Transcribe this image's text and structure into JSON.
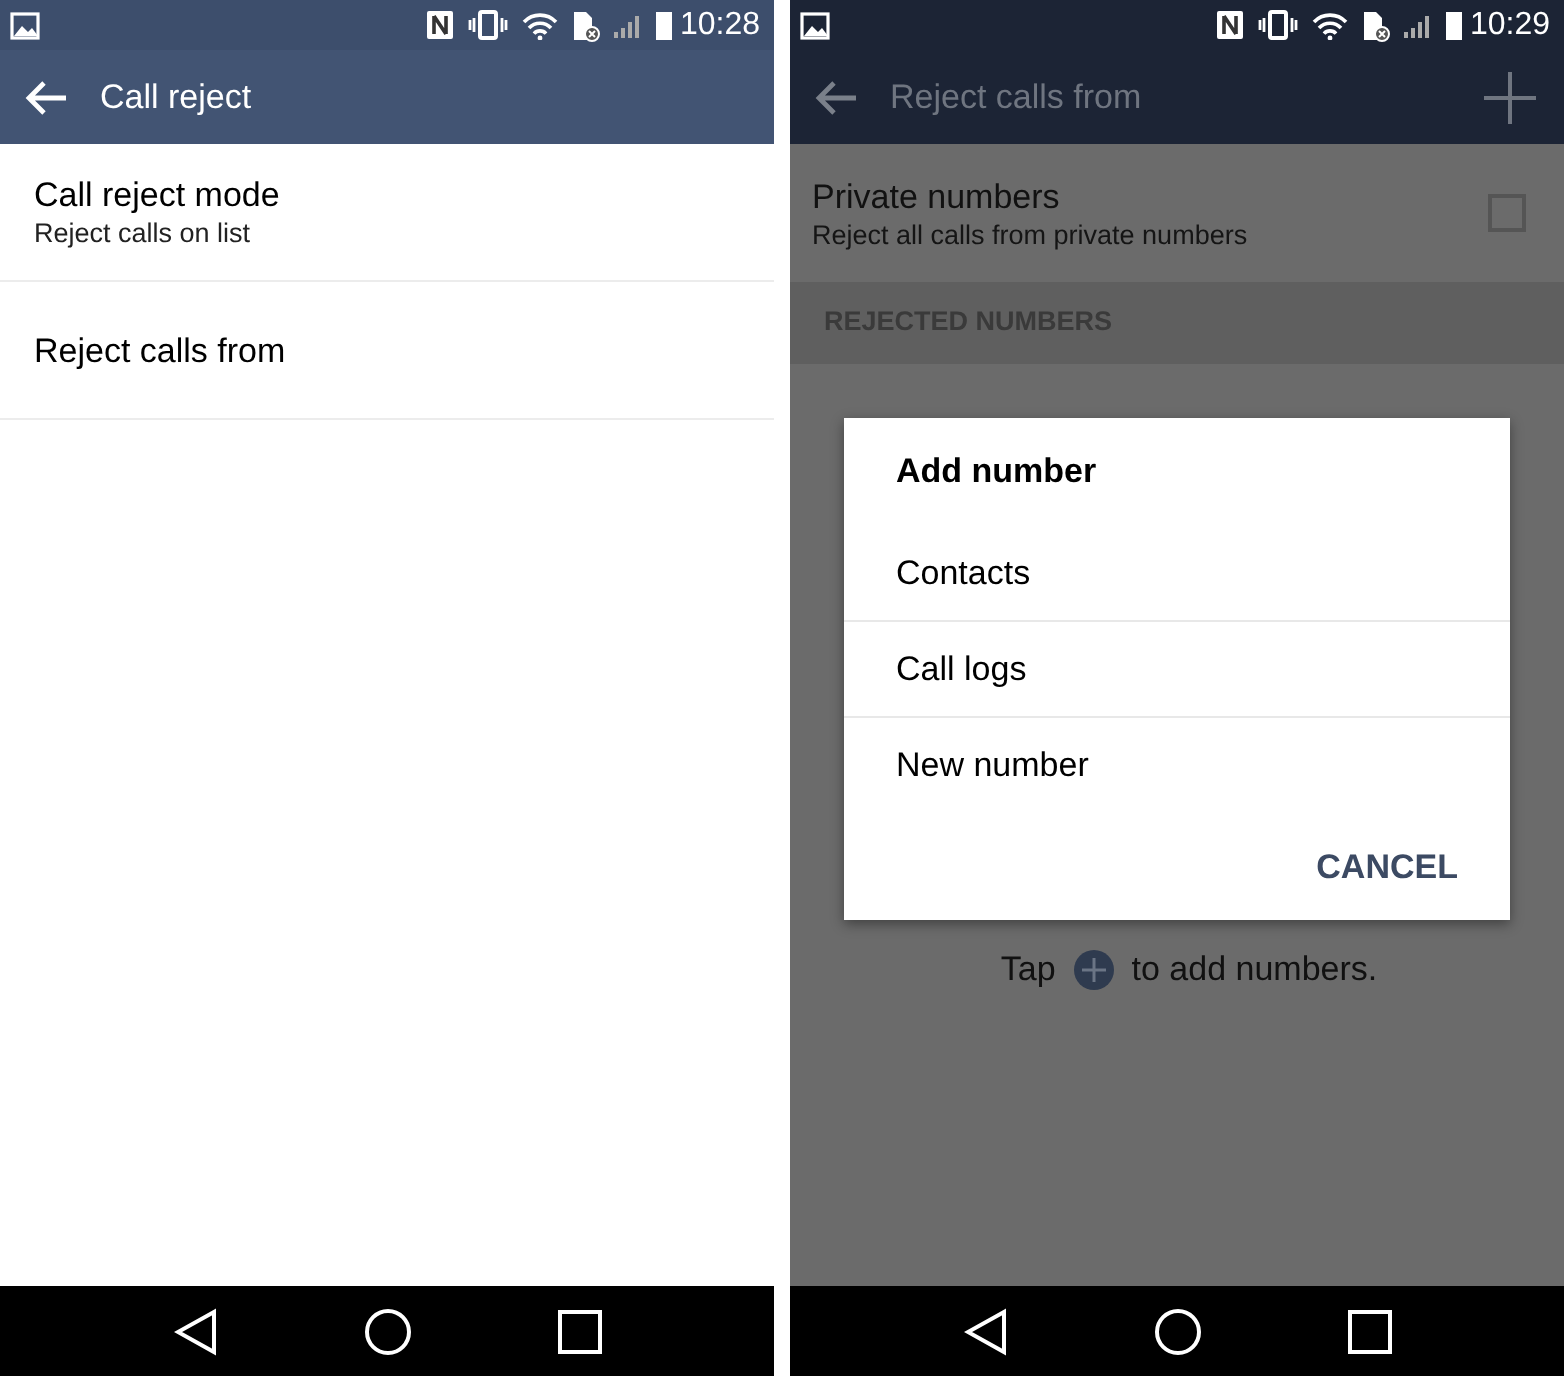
{
  "screens": [
    {
      "status_bar": {
        "time": "10:28"
      },
      "toolbar": {
        "title": "Call reject",
        "add_button": false
      },
      "dimmed": false,
      "items": [
        {
          "kind": "setting",
          "title": "Call reject mode",
          "subtitle": "Reject calls on list"
        },
        {
          "kind": "setting",
          "title": "Reject calls from"
        }
      ]
    },
    {
      "status_bar": {
        "time": "10:29"
      },
      "toolbar": {
        "title": "Reject calls from",
        "add_button": true
      },
      "dimmed": true,
      "items": [
        {
          "kind": "checkbox",
          "title": "Private numbers",
          "subtitle": "Reject all calls from private numbers",
          "checked": false
        },
        {
          "kind": "header",
          "title": "REJECTED NUMBERS"
        },
        {
          "kind": "hint",
          "before": "Tap",
          "after": "to add numbers."
        }
      ],
      "dialog": {
        "title": "Add number",
        "options": [
          "Contacts",
          "Call logs",
          "New number"
        ],
        "button": "CANCEL"
      }
    }
  ]
}
